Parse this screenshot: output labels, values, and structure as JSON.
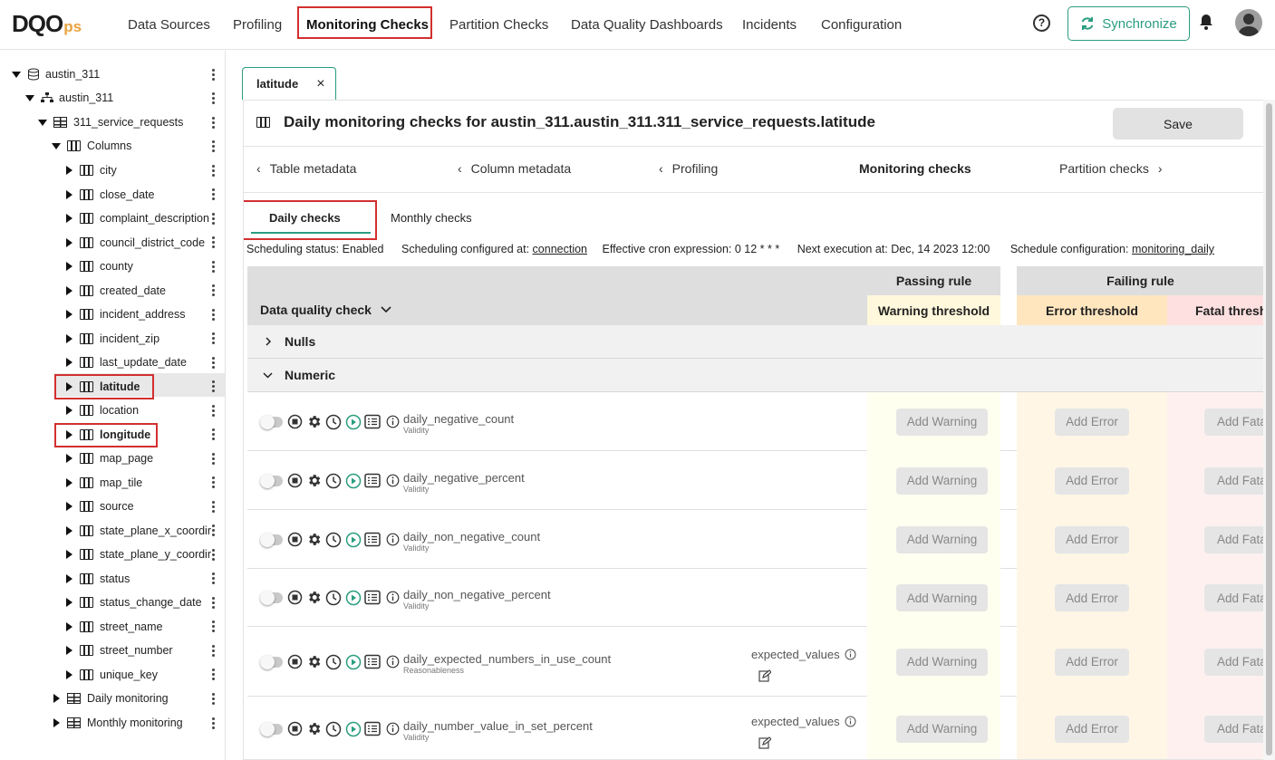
{
  "header": {
    "logo_main": "DQO",
    "logo_suffix": "ps",
    "nav": [
      "Data Sources",
      "Profiling",
      "Monitoring Checks",
      "Partition Checks",
      "Data Quality Dashboards",
      "Incidents",
      "Configuration"
    ],
    "help_label": "?",
    "sync_label": "Synchronize"
  },
  "tree": {
    "connection": "austin_311",
    "schema": "austin_311",
    "table": "311_service_requests",
    "columns_label": "Columns",
    "columns": [
      "city",
      "close_date",
      "complaint_description",
      "council_district_code",
      "county",
      "created_date",
      "incident_address",
      "incident_zip",
      "last_update_date",
      "latitude",
      "location",
      "longitude",
      "map_page",
      "map_tile",
      "source",
      "state_plane_x_coordir",
      "state_plane_y_coordir",
      "status",
      "status_change_date",
      "street_name",
      "street_number",
      "unique_key"
    ],
    "daily_monitoring": "Daily monitoring",
    "monthly_monitoring": "Monthly monitoring"
  },
  "tab": {
    "label": "latitude",
    "close": "×"
  },
  "main": {
    "title": "Daily monitoring checks for austin_311.austin_311.311_service_requests.latitude",
    "save_label": "Save",
    "breadcrumbs": [
      "Table metadata",
      "Column metadata",
      "Profiling",
      "Monitoring checks",
      "Partition checks"
    ],
    "subtabs": [
      "Daily checks",
      "Monthly checks"
    ],
    "schedule": {
      "status": "Scheduling status: Enabled",
      "configured_label": "Scheduling configured at:",
      "configured_value": "connection",
      "cron": "Effective cron expression: 0 12 * * *",
      "next": "Next execution at: Dec, 14 2023 12:00",
      "config_label": "Schedule configuration:",
      "config_value": "monitoring_daily"
    }
  },
  "grid": {
    "check_header": "Data quality check",
    "passing_rule": "Passing rule",
    "failing_rule": "Failing rule",
    "warning_threshold": "Warning threshold",
    "error_threshold": "Error threshold",
    "fatal_threshold": "Fatal thresh",
    "groups": [
      "Nulls",
      "Numeric"
    ],
    "add_warning": "Add Warning",
    "add_error": "Add Error",
    "add_fatal": "Add Fata",
    "checks": [
      {
        "name": "daily_negative_count",
        "type": "Validity",
        "param": ""
      },
      {
        "name": "daily_negative_percent",
        "type": "Validity",
        "param": ""
      },
      {
        "name": "daily_non_negative_count",
        "type": "Validity",
        "param": ""
      },
      {
        "name": "daily_non_negative_percent",
        "type": "Validity",
        "param": ""
      },
      {
        "name": "daily_expected_numbers_in_use_count",
        "type": "Reasonableness",
        "param": "expected_values"
      },
      {
        "name": "daily_number_value_in_set_percent",
        "type": "Validity",
        "param": "expected_values"
      }
    ]
  },
  "colors": {
    "accent": "#2a9d7f",
    "highlight": "#d32f2f"
  }
}
